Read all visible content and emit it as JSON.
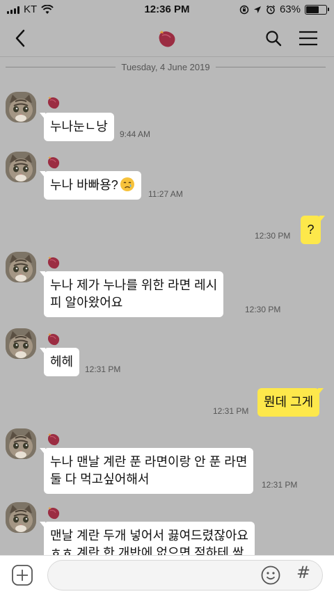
{
  "status_bar": {
    "carrier": "KT",
    "time": "12:36 PM",
    "battery_percent": "63%",
    "battery_level": 0.63
  },
  "date_separator": "Tuesday, 4 June 2019",
  "messages": [
    {
      "side": "in",
      "lines": [
        "누나눈ㄴ낭"
      ],
      "time": "9:44 AM"
    },
    {
      "side": "in",
      "lines": [
        "누나 바빠용?"
      ],
      "emoji": "crying-face",
      "time": "11:27 AM"
    },
    {
      "side": "out",
      "lines": [
        "?"
      ],
      "time": "12:30 PM"
    },
    {
      "side": "in",
      "lines": [
        "누나 제가 누나를 위한 라면 레시",
        "피 알아왔어요"
      ],
      "time": "12:30 PM"
    },
    {
      "side": "in",
      "lines": [
        "헤헤"
      ],
      "time": "12:31 PM"
    },
    {
      "side": "out",
      "lines": [
        "뭔데 그게"
      ],
      "time": "12:31 PM"
    },
    {
      "side": "in",
      "lines": [
        "누나 맨날 계란 푼 라면이랑 안 푼 라면",
        "둘 다 먹고싶어해서"
      ],
      "time": "12:31 PM"
    },
    {
      "side": "in",
      "lines": [
        "맨날 계란 두개 넣어서 끓여드렸잖아요",
        "ㅎㅎ 계란 한 개반에 없으면 적하테 싹"
      ]
    }
  ],
  "colors": {
    "chat_bg": "#b9b9b9",
    "my_bubble": "#fde84b",
    "their_bubble": "#ffffff"
  }
}
